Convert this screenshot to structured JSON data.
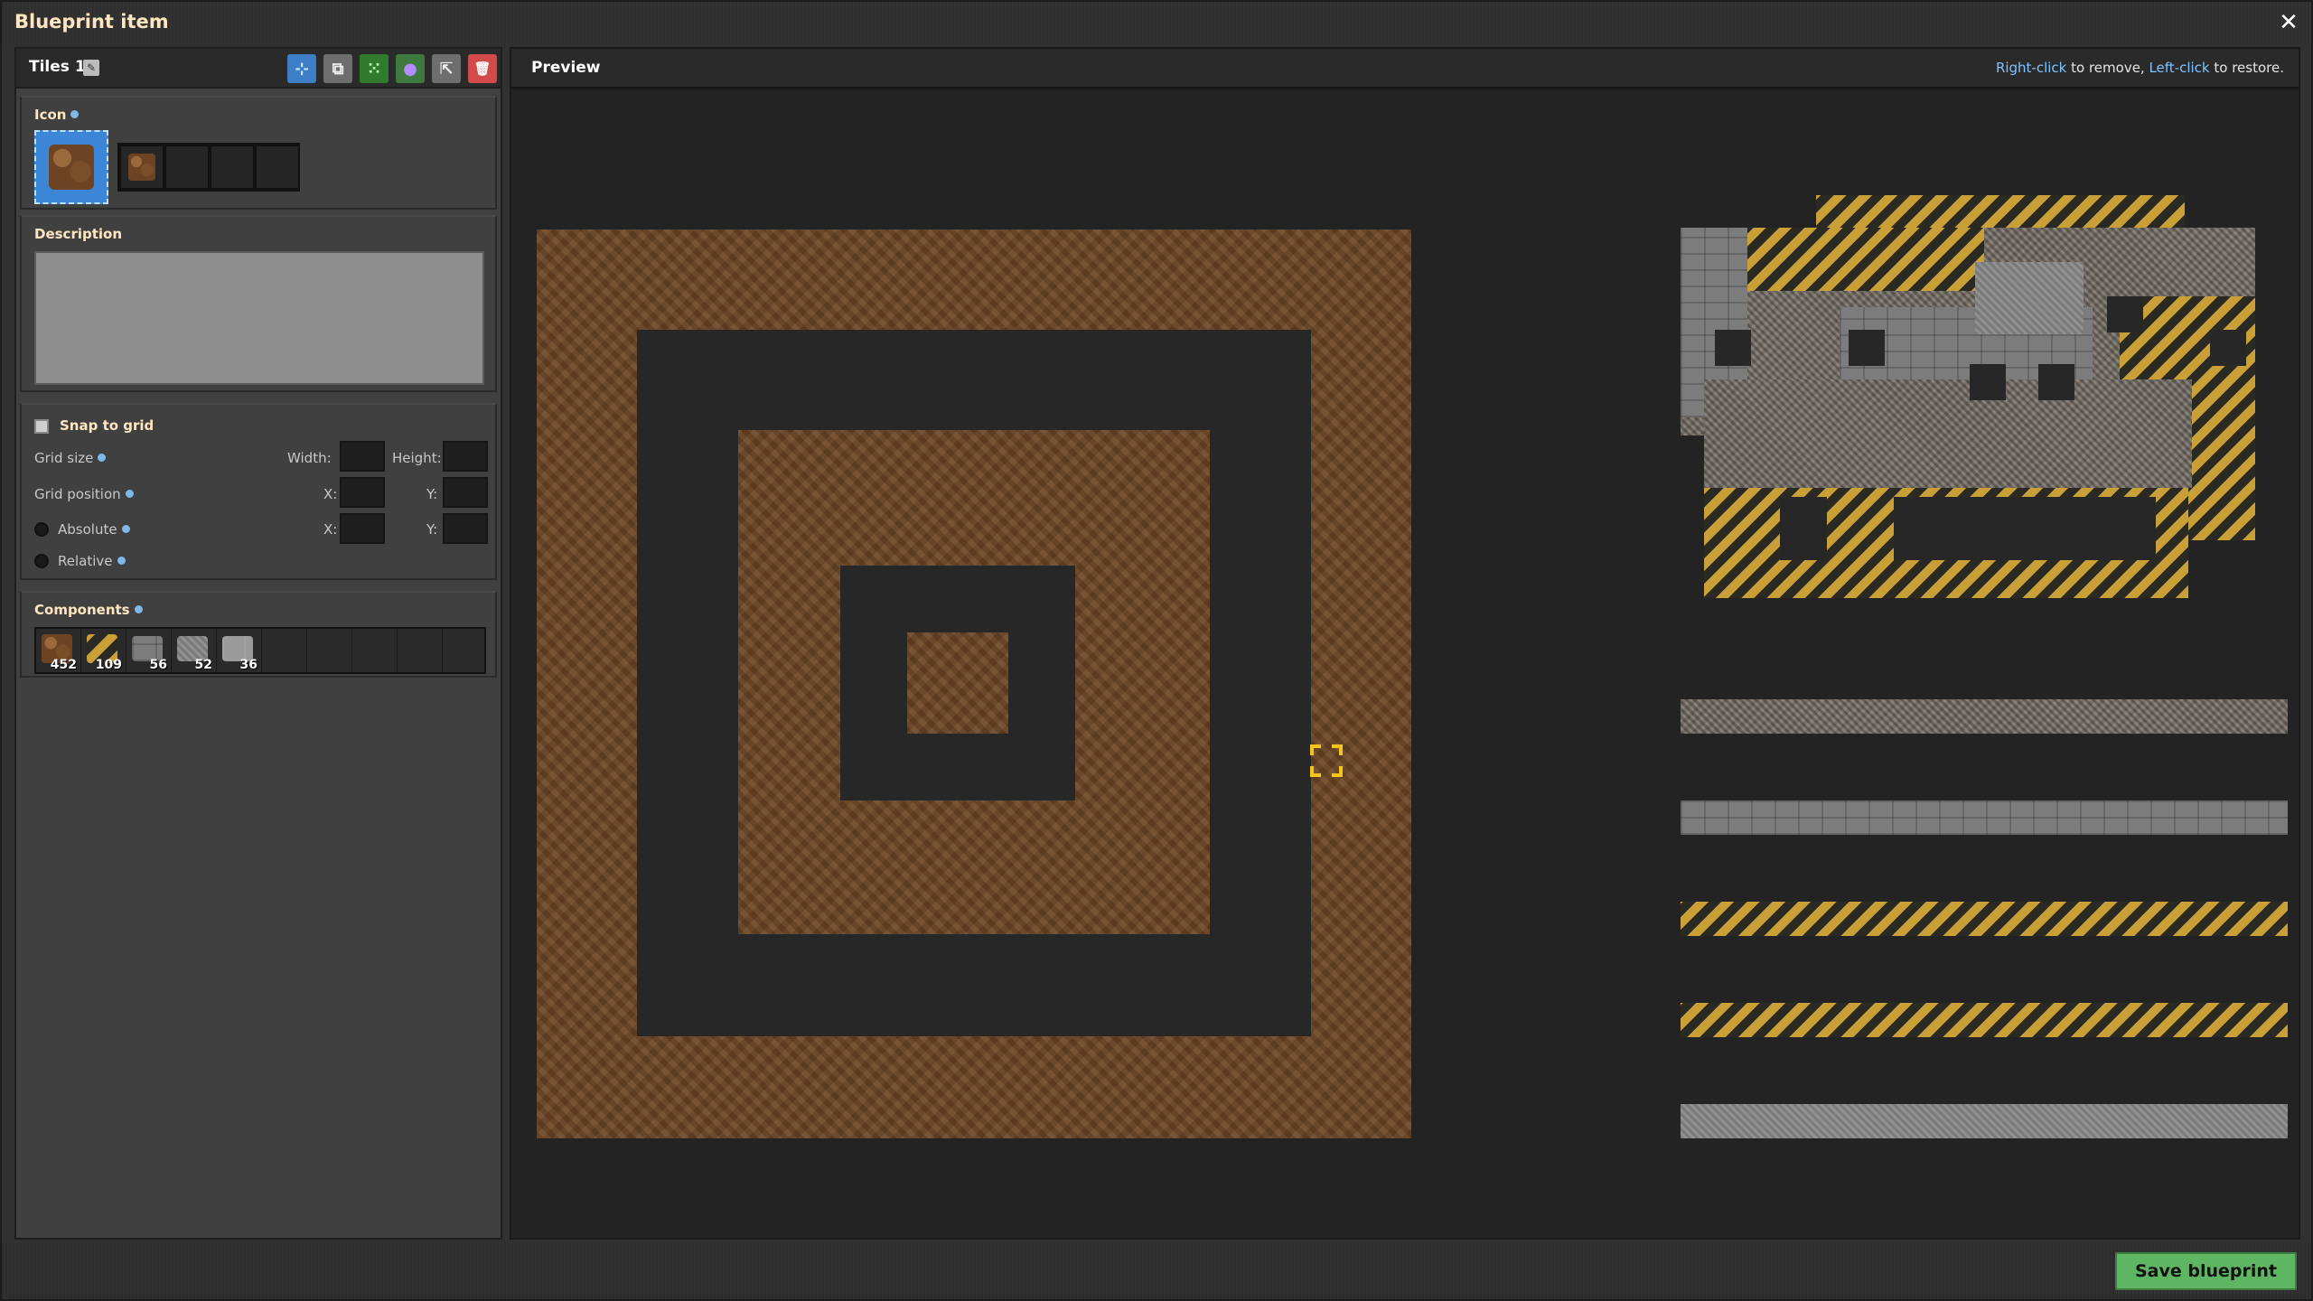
{
  "window": {
    "title": "Blueprint item",
    "close_glyph": "✕"
  },
  "left": {
    "blueprint_name": "Tiles 1",
    "toolbar": [
      {
        "name": "select-new-contents",
        "glyph": "⊹",
        "color": "#3d7fc6"
      },
      {
        "name": "copy-blueprint",
        "glyph": "⧉",
        "color": "#6e6e6e"
      },
      {
        "name": "select-area",
        "glyph": "⁙",
        "color": "#3a9a3a"
      },
      {
        "name": "color-select",
        "glyph": "●",
        "color": "#5a5a5a"
      },
      {
        "name": "export-string",
        "glyph": "⇱",
        "color": "#6e6e6e"
      },
      {
        "name": "delete-blueprint",
        "glyph": "🗑",
        "color": "#d34a4a"
      }
    ],
    "icon_section": {
      "label": "Icon",
      "primary_icon": "landfill",
      "extra_icons": [
        "landfill",
        "",
        "",
        ""
      ]
    },
    "description": {
      "label": "Description",
      "value": ""
    },
    "snap": {
      "label": "Snap to grid",
      "grid_size_label": "Grid size",
      "width_label": "Width:",
      "height_label": "Height:",
      "grid_position_label": "Grid position",
      "x_label": "X:",
      "y_label": "Y:",
      "absolute_label": "Absolute",
      "relative_label": "Relative"
    },
    "components": {
      "label": "Components",
      "items": [
        {
          "icon": "landfill-icon",
          "count": "452"
        },
        {
          "icon": "hazard-concrete-icon",
          "count": "109"
        },
        {
          "icon": "stone-brick-icon",
          "count": "56"
        },
        {
          "icon": "concrete-icon",
          "count": "52"
        },
        {
          "icon": "refined-concrete-icon",
          "count": "36"
        }
      ]
    }
  },
  "preview": {
    "title": "Preview",
    "hint_key1": "Right-click",
    "hint_mid": " to remove, ",
    "hint_key2": "Left-click",
    "hint_end": " to restore."
  },
  "footer": {
    "save_label": "Save blueprint"
  }
}
